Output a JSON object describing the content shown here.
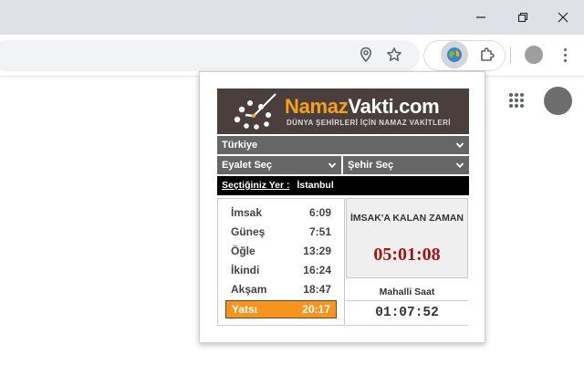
{
  "browser": {
    "window_controls": {
      "minimize": "minimize-icon",
      "restore": "restore-icon",
      "close": "close-icon"
    },
    "toolbar_icons": [
      "location-pin-icon",
      "star-icon",
      "globe-extension-icon",
      "puzzle-icon",
      "profile-icon",
      "more-menu-icon"
    ]
  },
  "page": {
    "icons": [
      "apps-grid-icon",
      "account-avatar"
    ]
  },
  "popup": {
    "brand": {
      "part1": "Namaz",
      "part2": "Vakti.com",
      "subtitle": "DÜNYA ŞEHİRLERİ İÇİN NAMAZ VAKİTLERİ"
    },
    "country_select": {
      "value": "Türkiye"
    },
    "state_select": {
      "value": "Eyalet Seç"
    },
    "city_select": {
      "value": "Şehir Seç"
    },
    "location": {
      "label": "Seçtiğiniz Yer :",
      "value": "İstanbul"
    },
    "prayer_times": [
      {
        "name": "İmsak",
        "time": "6:09"
      },
      {
        "name": "Güneş",
        "time": "7:51"
      },
      {
        "name": "Öğle",
        "time": "13:29"
      },
      {
        "name": "İkindi",
        "time": "16:24"
      },
      {
        "name": "Akşam",
        "time": "18:47"
      },
      {
        "name": "Yatsı",
        "time": "20:17"
      }
    ],
    "active_prayer_index": 5,
    "remaining": {
      "label": "İMSAK'A KALAN ZAMAN",
      "value": "05:01:08"
    },
    "local_time": {
      "label": "Mahalli Saat",
      "value": "01:07:52"
    },
    "colors": {
      "highlight": "#f7941d",
      "countdown": "#a31515",
      "bar": "#666666",
      "banner": "#4a3f3c",
      "brand_accent": "#f7a11a"
    }
  }
}
